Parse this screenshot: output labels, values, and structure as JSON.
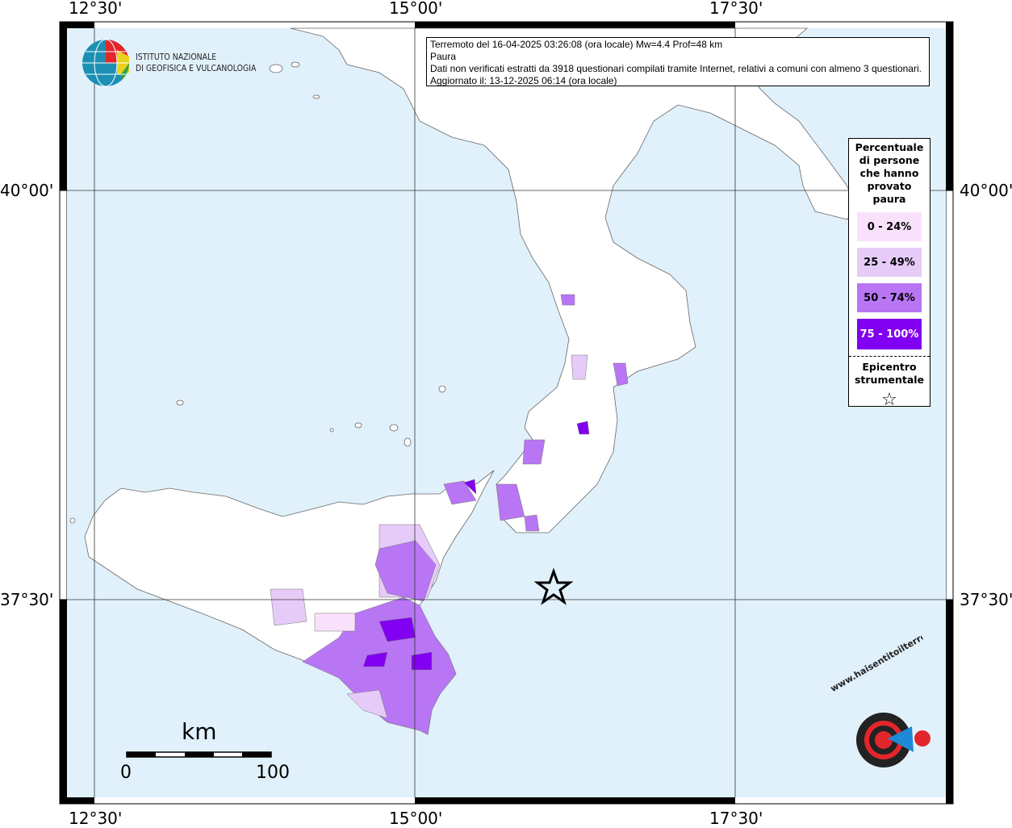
{
  "info": {
    "line1": "Terremoto del 16-04-2025 03:26:08 (ora locale) Mw=4.4 Prof=48 km",
    "line2": "Paura",
    "line3": "Dati non verificati estratti da 3918 questionari compilati tramite Internet, relativi a comuni con almeno 3 questionari.",
    "line4": "Aggiornato il: 13-12-2025 06:14 (ora locale)"
  },
  "axes": {
    "lon": [
      "12°30'",
      "15°00'",
      "17°30'"
    ],
    "lat": [
      "40°00'",
      "37°30'"
    ]
  },
  "logo_ingv": {
    "line1": "ISTITUTO NAZIONALE",
    "line2": "DI GEOFISICA E VULCANOLOGIA"
  },
  "logo_hsit": "www.haisentitoilterremoto.it",
  "legend": {
    "title": "Percentuale di persone che hanno provato paura",
    "classes": [
      {
        "label": "0 - 24%",
        "color": "#fae1fb"
      },
      {
        "label": "25 - 49%",
        "color": "#e6cbf8"
      },
      {
        "label": "50 - 74%",
        "color": "#b876f5"
      },
      {
        "label": "75 - 100%",
        "color": "#8200f2"
      }
    ],
    "epicenter_label": "Epicentro strumentale",
    "epicenter_symbol": "☆"
  },
  "scalebar": {
    "unit": "km",
    "min": "0",
    "max": "100"
  },
  "colors": {
    "sea": "#e1f1fc",
    "land": "#ffffff"
  }
}
